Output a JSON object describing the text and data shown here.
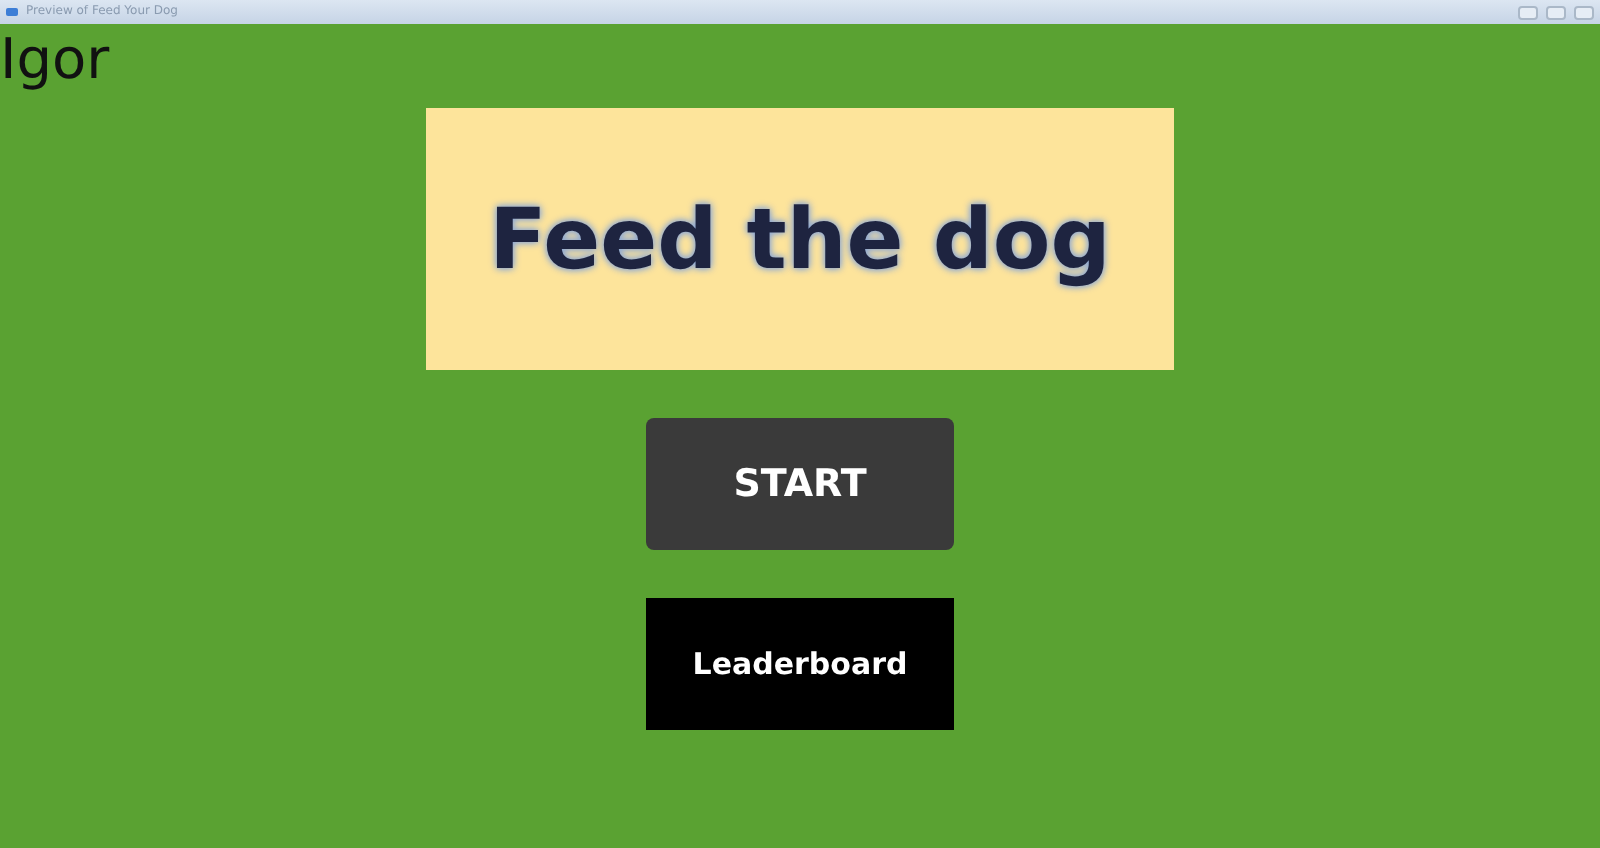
{
  "window": {
    "title": "Preview of Feed Your Dog"
  },
  "player_name": "Igor",
  "game_title": "Feed the dog",
  "buttons": [
    {
      "label": "START",
      "kind": "primary"
    },
    {
      "label": "Leaderboard",
      "kind": "secondary"
    }
  ]
}
